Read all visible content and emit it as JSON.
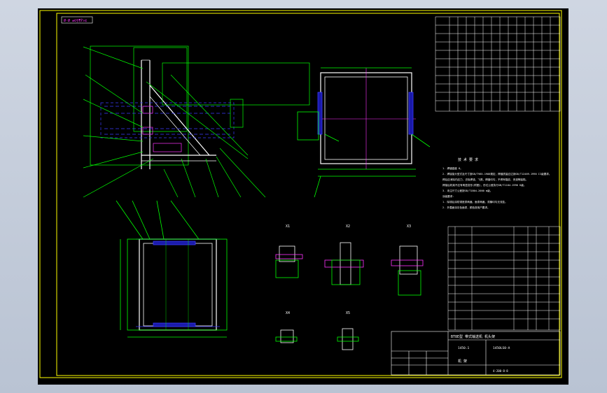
{
  "corner_tag": "Ø·Ø ±©§¶Ý¤¢",
  "tech_req": {
    "title": "技 术 要 求",
    "lines": [
      "1. 焊缝高度 8。",
      "2. 焊接接头型式及尺寸按GB/T985-1988规定，焊缝质量应达到GB/T12469-1990 II级要求。",
      "   焊后应消除内应力，去除焊渣、飞溅，焊缝均匀，不得有裂纹、夹渣等缺陷。",
      "   焊接后机架不应有明显变形(附图)，形位公差执行GB/T1184-1996 K级。",
      "3. 未注尺寸公差按GB/T1804-2000 m级。",
      "   涂装要求：",
      "1. 除锈后涂防锈底漆两遍，面漆两遍，漆膜均匀无流挂。",
      "2. 外露面涂灰色面漆，颜色按用户要求。"
    ]
  },
  "title_block": {
    "product": "BT8E型 带式输送机 机头架",
    "drawing_no": "1450.1",
    "drawing_no_2": "1450LS0-A",
    "name": "机 架",
    "code": "4-200-8-8"
  },
  "detail_labels": [
    "X1",
    "X2",
    "X3",
    "X4",
    "X5"
  ],
  "colors": {
    "background": "#000000",
    "line": "#ffffff",
    "dimension": "#00ff00",
    "text": "#ff00ff",
    "hidden": "#3a3aff",
    "section": "#ff33ff",
    "border": "#ffff00"
  }
}
